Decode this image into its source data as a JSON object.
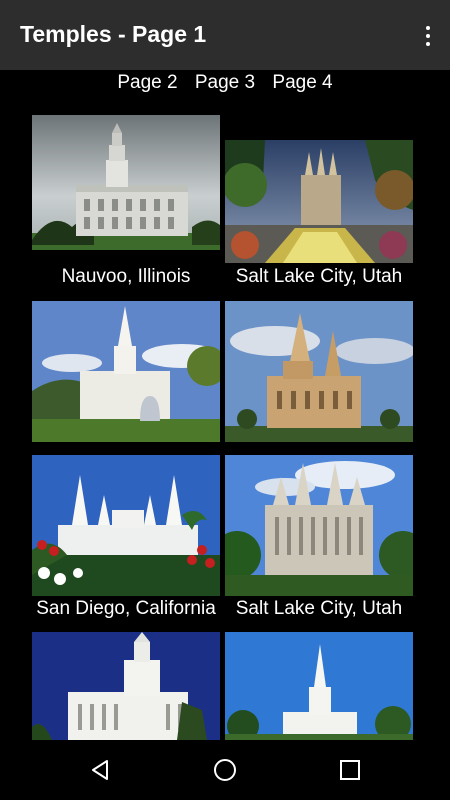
{
  "appbar": {
    "title": "Temples - Page 1",
    "menu_icon": "more-vert-icon"
  },
  "page_links": [
    "Page 2",
    "Page 3",
    "Page 4"
  ],
  "temples": [
    {
      "caption": "Nauvoo, Illinois"
    },
    {
      "caption": "Salt Lake City, Utah"
    },
    {
      "caption": ""
    },
    {
      "caption": ""
    },
    {
      "caption": "San Diego, California"
    },
    {
      "caption": "Salt Lake City, Utah"
    },
    {
      "caption": ""
    },
    {
      "caption": ""
    }
  ],
  "navbar": {
    "back_icon": "back-triangle-icon",
    "home_icon": "home-circle-icon",
    "recents_icon": "recents-square-icon"
  }
}
